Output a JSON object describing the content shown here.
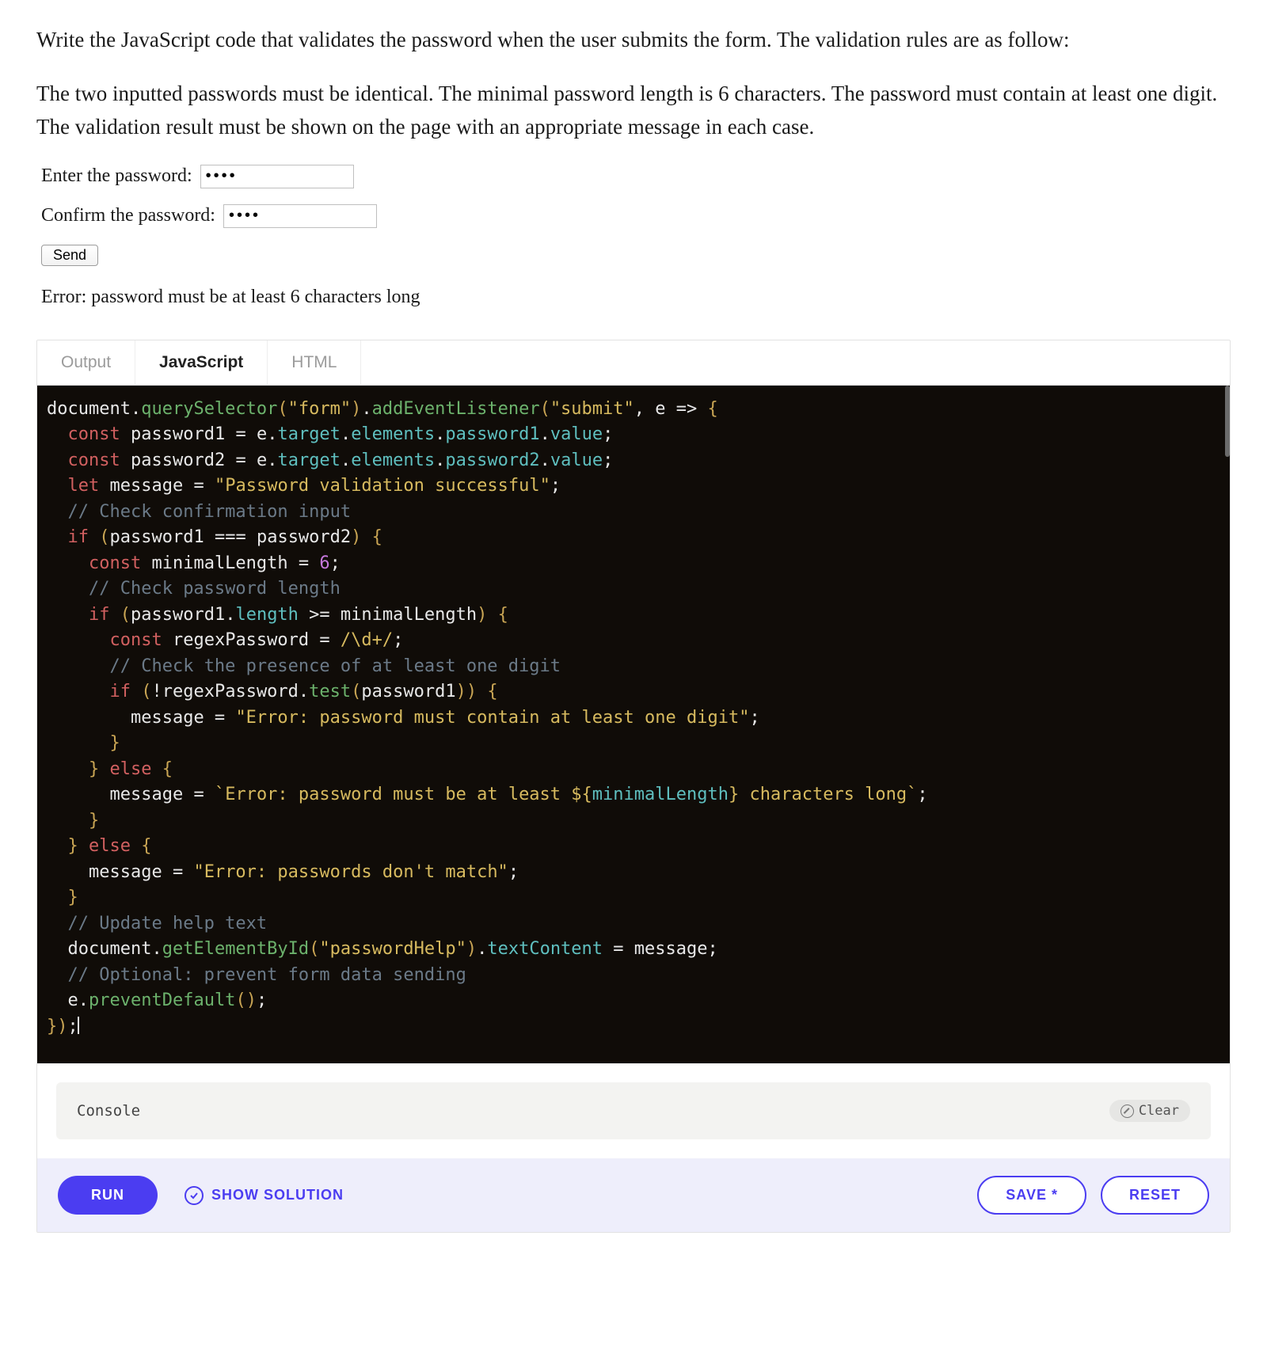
{
  "prose": {
    "intro": "Write the JavaScript code that validates the password when the user submits the form. The validation rules are as follow:",
    "rules": "The two inputted passwords must be identical. The minimal password length is 6 characters. The password must contain at least one digit. The validation result must be shown on the page with an appropriate message in each case."
  },
  "demo": {
    "label1": "Enter the password:",
    "label2": "Confirm the password:",
    "pw1_value": "••••",
    "pw2_value": "••••",
    "send_label": "Send",
    "error_text": "Error: password must be at least 6 characters long"
  },
  "tabs": {
    "output": "Output",
    "javascript": "JavaScript",
    "html": "HTML"
  },
  "code": {
    "line1": {
      "pre": "document",
      "dot1": ".",
      "fn1": "querySelector",
      "open1": "(",
      "arg1": "\"form\"",
      "close1": ")",
      "dot2": ".",
      "fn2": "addEventListener",
      "open2": "(",
      "arg2": "\"submit\"",
      "comma": ", ",
      "param": "e",
      "arrow": " => ",
      "brace": "{"
    },
    "line2": {
      "kw": "const",
      "sp": " ",
      "name": "password1",
      "eq": " = ",
      "e": "e",
      "d1": ".",
      "p1": "target",
      "d2": ".",
      "p2": "elements",
      "d3": ".",
      "p3": "password1",
      "d4": ".",
      "p4": "value",
      "semi": ";"
    },
    "line3": {
      "kw": "const",
      "sp": " ",
      "name": "password2",
      "eq": " = ",
      "e": "e",
      "d1": ".",
      "p1": "target",
      "d2": ".",
      "p2": "elements",
      "d3": ".",
      "p3": "password2",
      "d4": ".",
      "p4": "value",
      "semi": ";"
    },
    "line4": {
      "kw": "let",
      "sp": " ",
      "name": "message",
      "eq": " = ",
      "str": "\"Password validation successful\"",
      "semi": ";"
    },
    "line5": {
      "cmt": "// Check confirmation input"
    },
    "line6": {
      "kw": "if",
      "open": " (",
      "a": "password1",
      "op": " === ",
      "b": "password2",
      "close": ") ",
      "brace": "{"
    },
    "line7": {
      "kw": "const",
      "sp": " ",
      "name": "minimalLength",
      "eq": " = ",
      "num": "6",
      "semi": ";"
    },
    "line8": {
      "cmt": "// Check password length"
    },
    "line9": {
      "kw": "if",
      "open": " (",
      "a": "password1",
      "dot": ".",
      "prop": "length",
      "op": " >= ",
      "b": "minimalLength",
      "close": ") ",
      "brace": "{"
    },
    "line10": {
      "kw": "const",
      "sp": " ",
      "name": "regexPassword",
      "eq": " = ",
      "regex": "/\\d+/",
      "semi": ";"
    },
    "line11": {
      "cmt": "// Check the presence of at least one digit"
    },
    "line12": {
      "kw": "if",
      "open": " (",
      "not": "!",
      "a": "regexPassword",
      "dot": ".",
      "fn": "test",
      "pa": "(",
      "arg": "password1",
      "pc": ")",
      "close": ") ",
      "brace": "{"
    },
    "line13": {
      "name": "message",
      "eq": " = ",
      "str": "\"Error: password must contain at least one digit\"",
      "semi": ";"
    },
    "line14": {
      "brace": "}"
    },
    "line15": {
      "brace": "}",
      "sp": " ",
      "kw": "else",
      "sp2": " ",
      "brace2": "{"
    },
    "line16": {
      "name": "message",
      "eq": " = ",
      "bt1": "`",
      "txt1": "Error: password must be at least ",
      "dol": "${",
      "var": "minimalLength",
      "cdol": "}",
      "txt2": " characters long",
      "bt2": "`",
      "semi": ";"
    },
    "line17": {
      "brace": "}"
    },
    "line18": {
      "brace": "}",
      "sp": " ",
      "kw": "else",
      "sp2": " ",
      "brace2": "{"
    },
    "line19": {
      "name": "message",
      "eq": " = ",
      "str": "\"Error: passwords don't match\"",
      "semi": ";"
    },
    "line20": {
      "brace": "}"
    },
    "line21": {
      "cmt": "// Update help text"
    },
    "line22": {
      "obj": "document",
      "dot": ".",
      "fn": "getElementById",
      "open": "(",
      "arg": "\"passwordHelp\"",
      "close": ")",
      "dot2": ".",
      "prop": "textContent",
      "eq": " = ",
      "var": "message",
      "semi": ";"
    },
    "line23": {
      "cmt": "// Optional: prevent form data sending"
    },
    "line24": {
      "e": "e",
      "dot": ".",
      "fn": "preventDefault",
      "open": "(",
      "close": ")",
      "semi": ";"
    },
    "line25": {
      "brace": "}",
      "close": ")",
      "semi": ";"
    }
  },
  "console": {
    "label": "Console",
    "clear": "Clear"
  },
  "footer": {
    "run": "RUN",
    "solution": "SHOW SOLUTION",
    "save": "SAVE *",
    "reset": "RESET"
  }
}
